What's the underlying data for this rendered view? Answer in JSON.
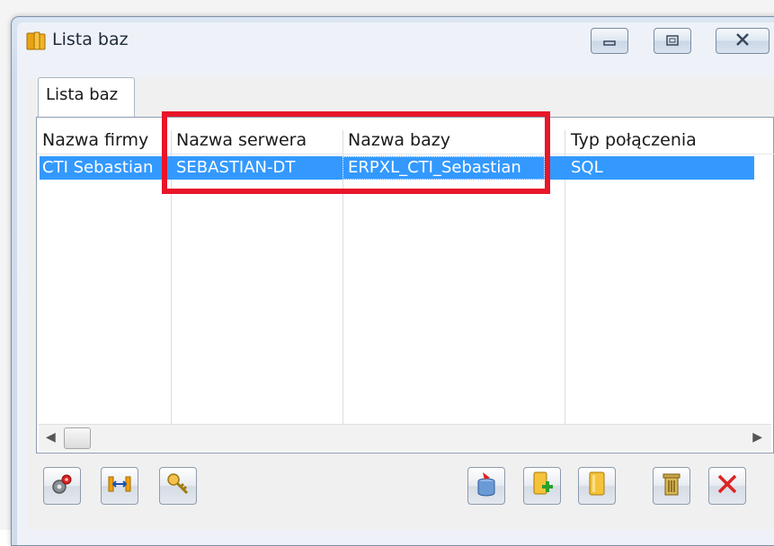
{
  "window": {
    "title": "Lista baz",
    "icon": "database-book-icon"
  },
  "titlebar": {
    "minimize_icon": "minimize-icon",
    "maximize_icon": "maximize-icon",
    "close_icon": "close-icon"
  },
  "tabs": [
    {
      "label": "Lista baz",
      "active": true
    }
  ],
  "table": {
    "columns": [
      "Nazwa firmy",
      "Nazwa serwera",
      "Nazwa bazy",
      "Typ połączenia"
    ],
    "rows": [
      [
        "CTI Sebastian",
        "SEBASTIAN-DT",
        "ERPXL_CTI_Sebastian",
        "SQL"
      ]
    ],
    "selected_row": 0
  },
  "toolbar": {
    "left": [
      {
        "name": "settings-button",
        "icon": "gear-icon"
      },
      {
        "name": "connect-button",
        "icon": "link-arrows-icon"
      },
      {
        "name": "search-button",
        "icon": "key-icon"
      }
    ],
    "right": [
      {
        "name": "import-button",
        "icon": "db-import-icon"
      },
      {
        "name": "add-database-button",
        "icon": "add-database-icon"
      },
      {
        "name": "attach-database-button",
        "icon": "database-icon"
      },
      {
        "name": "delete-button",
        "icon": "trash-icon"
      },
      {
        "name": "remove-button",
        "icon": "red-x-icon"
      }
    ]
  },
  "colors": {
    "selection": "#3399ff",
    "highlight_box": "#e8162a"
  }
}
